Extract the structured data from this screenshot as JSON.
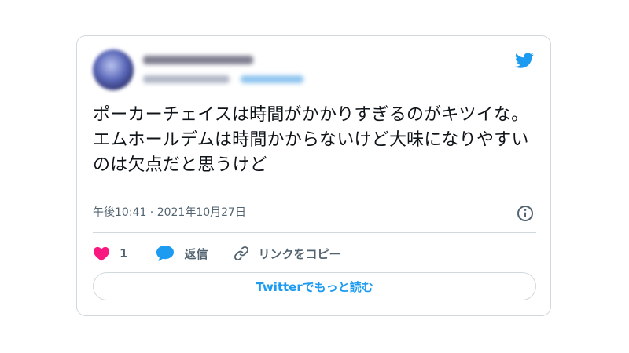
{
  "tweet": {
    "text": "ポーカーチェイスは時間がかかりすぎるのがキツイな。\nエムホールデムは時間かからないけど大味になりやすいのは欠点だと思うけど",
    "timestamp": "午後10:41 · 2021年10月27日"
  },
  "actions": {
    "like_count": "1",
    "reply_label": "返信",
    "copy_link_label": "リンクをコピー"
  },
  "read_more_label": "Twitterでもっと読む",
  "colors": {
    "brand_blue": "#1d9bf0",
    "like_pink": "#f91880",
    "secondary_text": "#536471",
    "border": "#cfd9de"
  },
  "icons": [
    "twitter-bird-icon",
    "info-icon",
    "heart-icon",
    "reply-bubble-icon",
    "link-icon"
  ]
}
